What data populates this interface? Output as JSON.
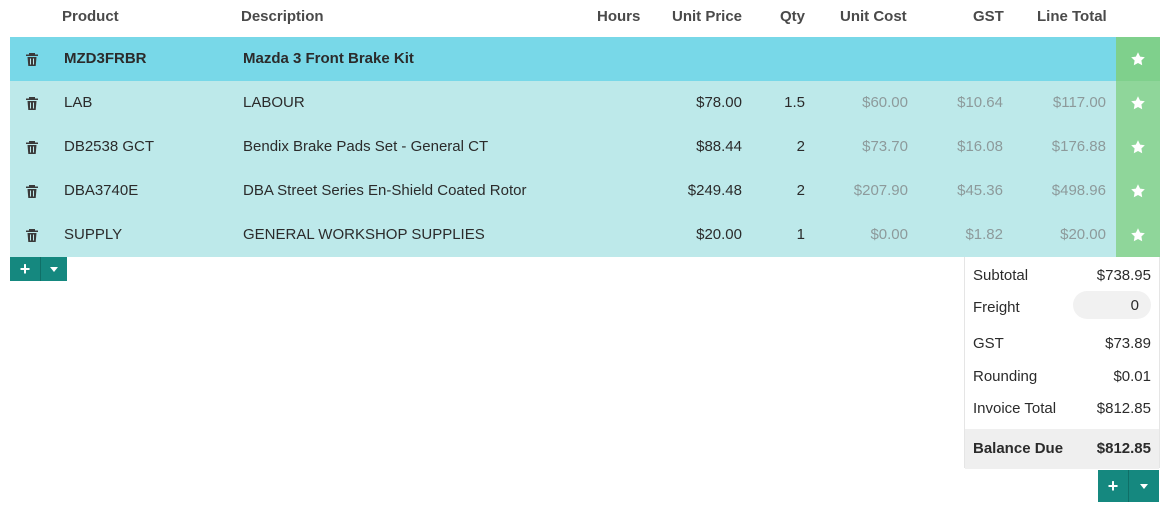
{
  "columns": {
    "product": "Product",
    "description": "Description",
    "hours": "Hours",
    "unit_price": "Unit Price",
    "qty": "Qty",
    "unit_cost": "Unit Cost",
    "gst": "GST",
    "line_total": "Line Total"
  },
  "kit_row": {
    "product": "MZD3FRBR",
    "description": "Mazda 3 Front Brake Kit"
  },
  "lines": [
    {
      "product": "LAB",
      "description": "LABOUR",
      "unit_price": "$78.00",
      "qty": "1.5",
      "unit_cost": "$60.00",
      "gst": "$10.64",
      "line_total": "$117.00"
    },
    {
      "product": "DB2538 GCT",
      "description": "Bendix Brake Pads Set - General CT",
      "unit_price": "$88.44",
      "qty": "2",
      "unit_cost": "$73.70",
      "gst": "$16.08",
      "line_total": "$176.88"
    },
    {
      "product": "DBA3740E",
      "description": "DBA Street Series En-Shield Coated Rotor",
      "unit_price": "$249.48",
      "qty": "2",
      "unit_cost": "$207.90",
      "gst": "$45.36",
      "line_total": "$498.96"
    },
    {
      "product": "SUPPLY",
      "description": "GENERAL WORKSHOP SUPPLIES",
      "unit_price": "$20.00",
      "qty": "1",
      "unit_cost": "$0.00",
      "gst": "$1.82",
      "line_total": "$20.00"
    }
  ],
  "totals": {
    "subtotal_label": "Subtotal",
    "subtotal": "$738.95",
    "freight_label": "Freight",
    "freight": "0",
    "gst_label": "GST",
    "gst": "$73.89",
    "rounding_label": "Rounding",
    "rounding": "$0.01",
    "invoice_total_label": "Invoice Total",
    "invoice_total": "$812.85",
    "balance_due_label": "Balance Due",
    "balance_due": "$812.85"
  },
  "buttons": {
    "add": "+"
  },
  "icons": {
    "delete": "trash-icon",
    "favorite": "star-icon",
    "dropdown": "caret-down-icon"
  },
  "colors": {
    "kit_row": "#78d8e8",
    "line_row": "#bde9ea",
    "star_cell": "#8fd69a",
    "button": "#15887f"
  }
}
